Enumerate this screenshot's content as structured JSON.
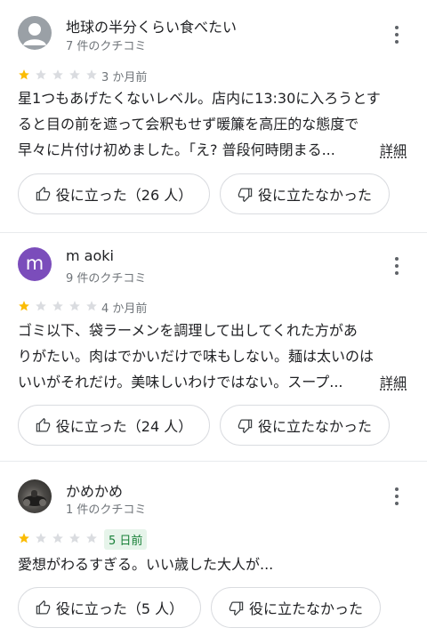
{
  "colors": {
    "star_filled": "#fbbc04",
    "star_empty": "#dadce0",
    "badge_green": "#188038",
    "avatar_purple": "#7b4dbb"
  },
  "reviews": [
    {
      "name": "地球の半分くらい食べたい",
      "count": "7 件のクチコミ",
      "avatar": "default-person-icon",
      "rating": 1,
      "when": "3 か月前",
      "lines": [
        "星1つもあげたくないレベル。店内に13:30に入ろうとす",
        "ると目の前を遮って会釈もせず暖簾を高圧的な態度で",
        "早々に片付け初めました。｢え? 普段何時閉まる..."
      ],
      "more": "詳細",
      "helpful": "役に立った（26 人）",
      "not_helpful": "役に立たなかった"
    },
    {
      "name": "m aoki",
      "count": "9 件のクチコミ",
      "avatar_letter": "m",
      "rating": 1,
      "when": "4 か月前",
      "lines": [
        "ゴミ以下、袋ラーメンを調理して出してくれた方があ",
        "りがたい。肉はでかいだけで味もしない。麺は太いのは",
        "いいがそれだけ。美味しいわけではない。スープ..."
      ],
      "more": "詳細",
      "helpful": "役に立った（24 人）",
      "not_helpful": "役に立たなかった"
    },
    {
      "name": "かめかめ",
      "count": "1 件のクチコミ",
      "avatar": "profile-photo",
      "rating": 1,
      "when": "5 日前",
      "lines": [
        "愛想がわるすぎる。いい歳した大人が..."
      ],
      "helpful": "役に立った（5 人）",
      "not_helpful": "役に立たなかった"
    }
  ]
}
